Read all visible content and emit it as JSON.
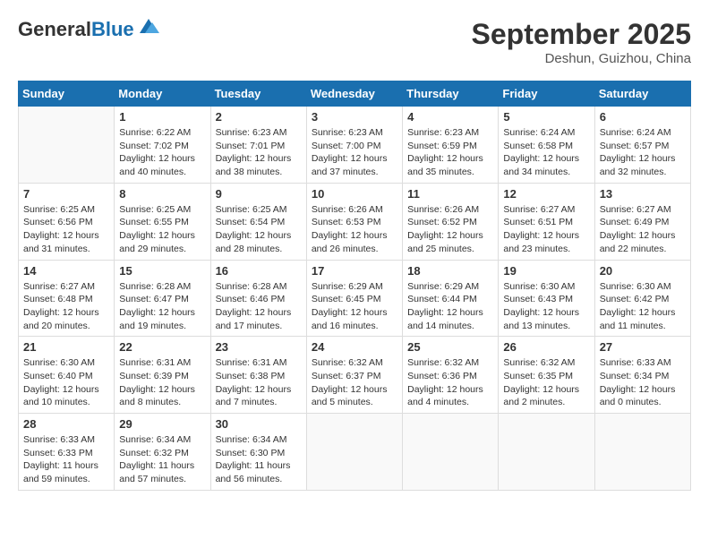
{
  "header": {
    "logo_general": "General",
    "logo_blue": "Blue",
    "month": "September 2025",
    "location": "Deshun, Guizhou, China"
  },
  "weekdays": [
    "Sunday",
    "Monday",
    "Tuesday",
    "Wednesday",
    "Thursday",
    "Friday",
    "Saturday"
  ],
  "weeks": [
    [
      {
        "day": "",
        "info": ""
      },
      {
        "day": "1",
        "info": "Sunrise: 6:22 AM\nSunset: 7:02 PM\nDaylight: 12 hours\nand 40 minutes."
      },
      {
        "day": "2",
        "info": "Sunrise: 6:23 AM\nSunset: 7:01 PM\nDaylight: 12 hours\nand 38 minutes."
      },
      {
        "day": "3",
        "info": "Sunrise: 6:23 AM\nSunset: 7:00 PM\nDaylight: 12 hours\nand 37 minutes."
      },
      {
        "day": "4",
        "info": "Sunrise: 6:23 AM\nSunset: 6:59 PM\nDaylight: 12 hours\nand 35 minutes."
      },
      {
        "day": "5",
        "info": "Sunrise: 6:24 AM\nSunset: 6:58 PM\nDaylight: 12 hours\nand 34 minutes."
      },
      {
        "day": "6",
        "info": "Sunrise: 6:24 AM\nSunset: 6:57 PM\nDaylight: 12 hours\nand 32 minutes."
      }
    ],
    [
      {
        "day": "7",
        "info": "Sunrise: 6:25 AM\nSunset: 6:56 PM\nDaylight: 12 hours\nand 31 minutes."
      },
      {
        "day": "8",
        "info": "Sunrise: 6:25 AM\nSunset: 6:55 PM\nDaylight: 12 hours\nand 29 minutes."
      },
      {
        "day": "9",
        "info": "Sunrise: 6:25 AM\nSunset: 6:54 PM\nDaylight: 12 hours\nand 28 minutes."
      },
      {
        "day": "10",
        "info": "Sunrise: 6:26 AM\nSunset: 6:53 PM\nDaylight: 12 hours\nand 26 minutes."
      },
      {
        "day": "11",
        "info": "Sunrise: 6:26 AM\nSunset: 6:52 PM\nDaylight: 12 hours\nand 25 minutes."
      },
      {
        "day": "12",
        "info": "Sunrise: 6:27 AM\nSunset: 6:51 PM\nDaylight: 12 hours\nand 23 minutes."
      },
      {
        "day": "13",
        "info": "Sunrise: 6:27 AM\nSunset: 6:49 PM\nDaylight: 12 hours\nand 22 minutes."
      }
    ],
    [
      {
        "day": "14",
        "info": "Sunrise: 6:27 AM\nSunset: 6:48 PM\nDaylight: 12 hours\nand 20 minutes."
      },
      {
        "day": "15",
        "info": "Sunrise: 6:28 AM\nSunset: 6:47 PM\nDaylight: 12 hours\nand 19 minutes."
      },
      {
        "day": "16",
        "info": "Sunrise: 6:28 AM\nSunset: 6:46 PM\nDaylight: 12 hours\nand 17 minutes."
      },
      {
        "day": "17",
        "info": "Sunrise: 6:29 AM\nSunset: 6:45 PM\nDaylight: 12 hours\nand 16 minutes."
      },
      {
        "day": "18",
        "info": "Sunrise: 6:29 AM\nSunset: 6:44 PM\nDaylight: 12 hours\nand 14 minutes."
      },
      {
        "day": "19",
        "info": "Sunrise: 6:30 AM\nSunset: 6:43 PM\nDaylight: 12 hours\nand 13 minutes."
      },
      {
        "day": "20",
        "info": "Sunrise: 6:30 AM\nSunset: 6:42 PM\nDaylight: 12 hours\nand 11 minutes."
      }
    ],
    [
      {
        "day": "21",
        "info": "Sunrise: 6:30 AM\nSunset: 6:40 PM\nDaylight: 12 hours\nand 10 minutes."
      },
      {
        "day": "22",
        "info": "Sunrise: 6:31 AM\nSunset: 6:39 PM\nDaylight: 12 hours\nand 8 minutes."
      },
      {
        "day": "23",
        "info": "Sunrise: 6:31 AM\nSunset: 6:38 PM\nDaylight: 12 hours\nand 7 minutes."
      },
      {
        "day": "24",
        "info": "Sunrise: 6:32 AM\nSunset: 6:37 PM\nDaylight: 12 hours\nand 5 minutes."
      },
      {
        "day": "25",
        "info": "Sunrise: 6:32 AM\nSunset: 6:36 PM\nDaylight: 12 hours\nand 4 minutes."
      },
      {
        "day": "26",
        "info": "Sunrise: 6:32 AM\nSunset: 6:35 PM\nDaylight: 12 hours\nand 2 minutes."
      },
      {
        "day": "27",
        "info": "Sunrise: 6:33 AM\nSunset: 6:34 PM\nDaylight: 12 hours\nand 0 minutes."
      }
    ],
    [
      {
        "day": "28",
        "info": "Sunrise: 6:33 AM\nSunset: 6:33 PM\nDaylight: 11 hours\nand 59 minutes."
      },
      {
        "day": "29",
        "info": "Sunrise: 6:34 AM\nSunset: 6:32 PM\nDaylight: 11 hours\nand 57 minutes."
      },
      {
        "day": "30",
        "info": "Sunrise: 6:34 AM\nSunset: 6:30 PM\nDaylight: 11 hours\nand 56 minutes."
      },
      {
        "day": "",
        "info": ""
      },
      {
        "day": "",
        "info": ""
      },
      {
        "day": "",
        "info": ""
      },
      {
        "day": "",
        "info": ""
      }
    ]
  ]
}
